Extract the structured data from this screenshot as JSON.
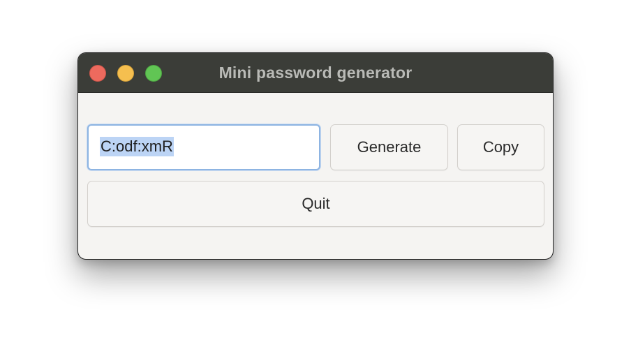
{
  "window": {
    "title": "Mini password generator",
    "controls": {
      "close": "close-button",
      "minimize": "minimize-button",
      "maximize": "maximize-button"
    }
  },
  "password_field": {
    "value": "C:odf:xmR",
    "selected": true
  },
  "buttons": {
    "generate_label": "Generate",
    "copy_label": "Copy",
    "quit_label": "Quit"
  },
  "colors": {
    "titlebar": "#3b3d38",
    "window_bg": "#f5f4f2",
    "focus_ring": "#8db4e2",
    "selection": "#bcd4f5",
    "close": "#ed6a5e",
    "minimize": "#f5bf4f",
    "maximize": "#61c554"
  }
}
